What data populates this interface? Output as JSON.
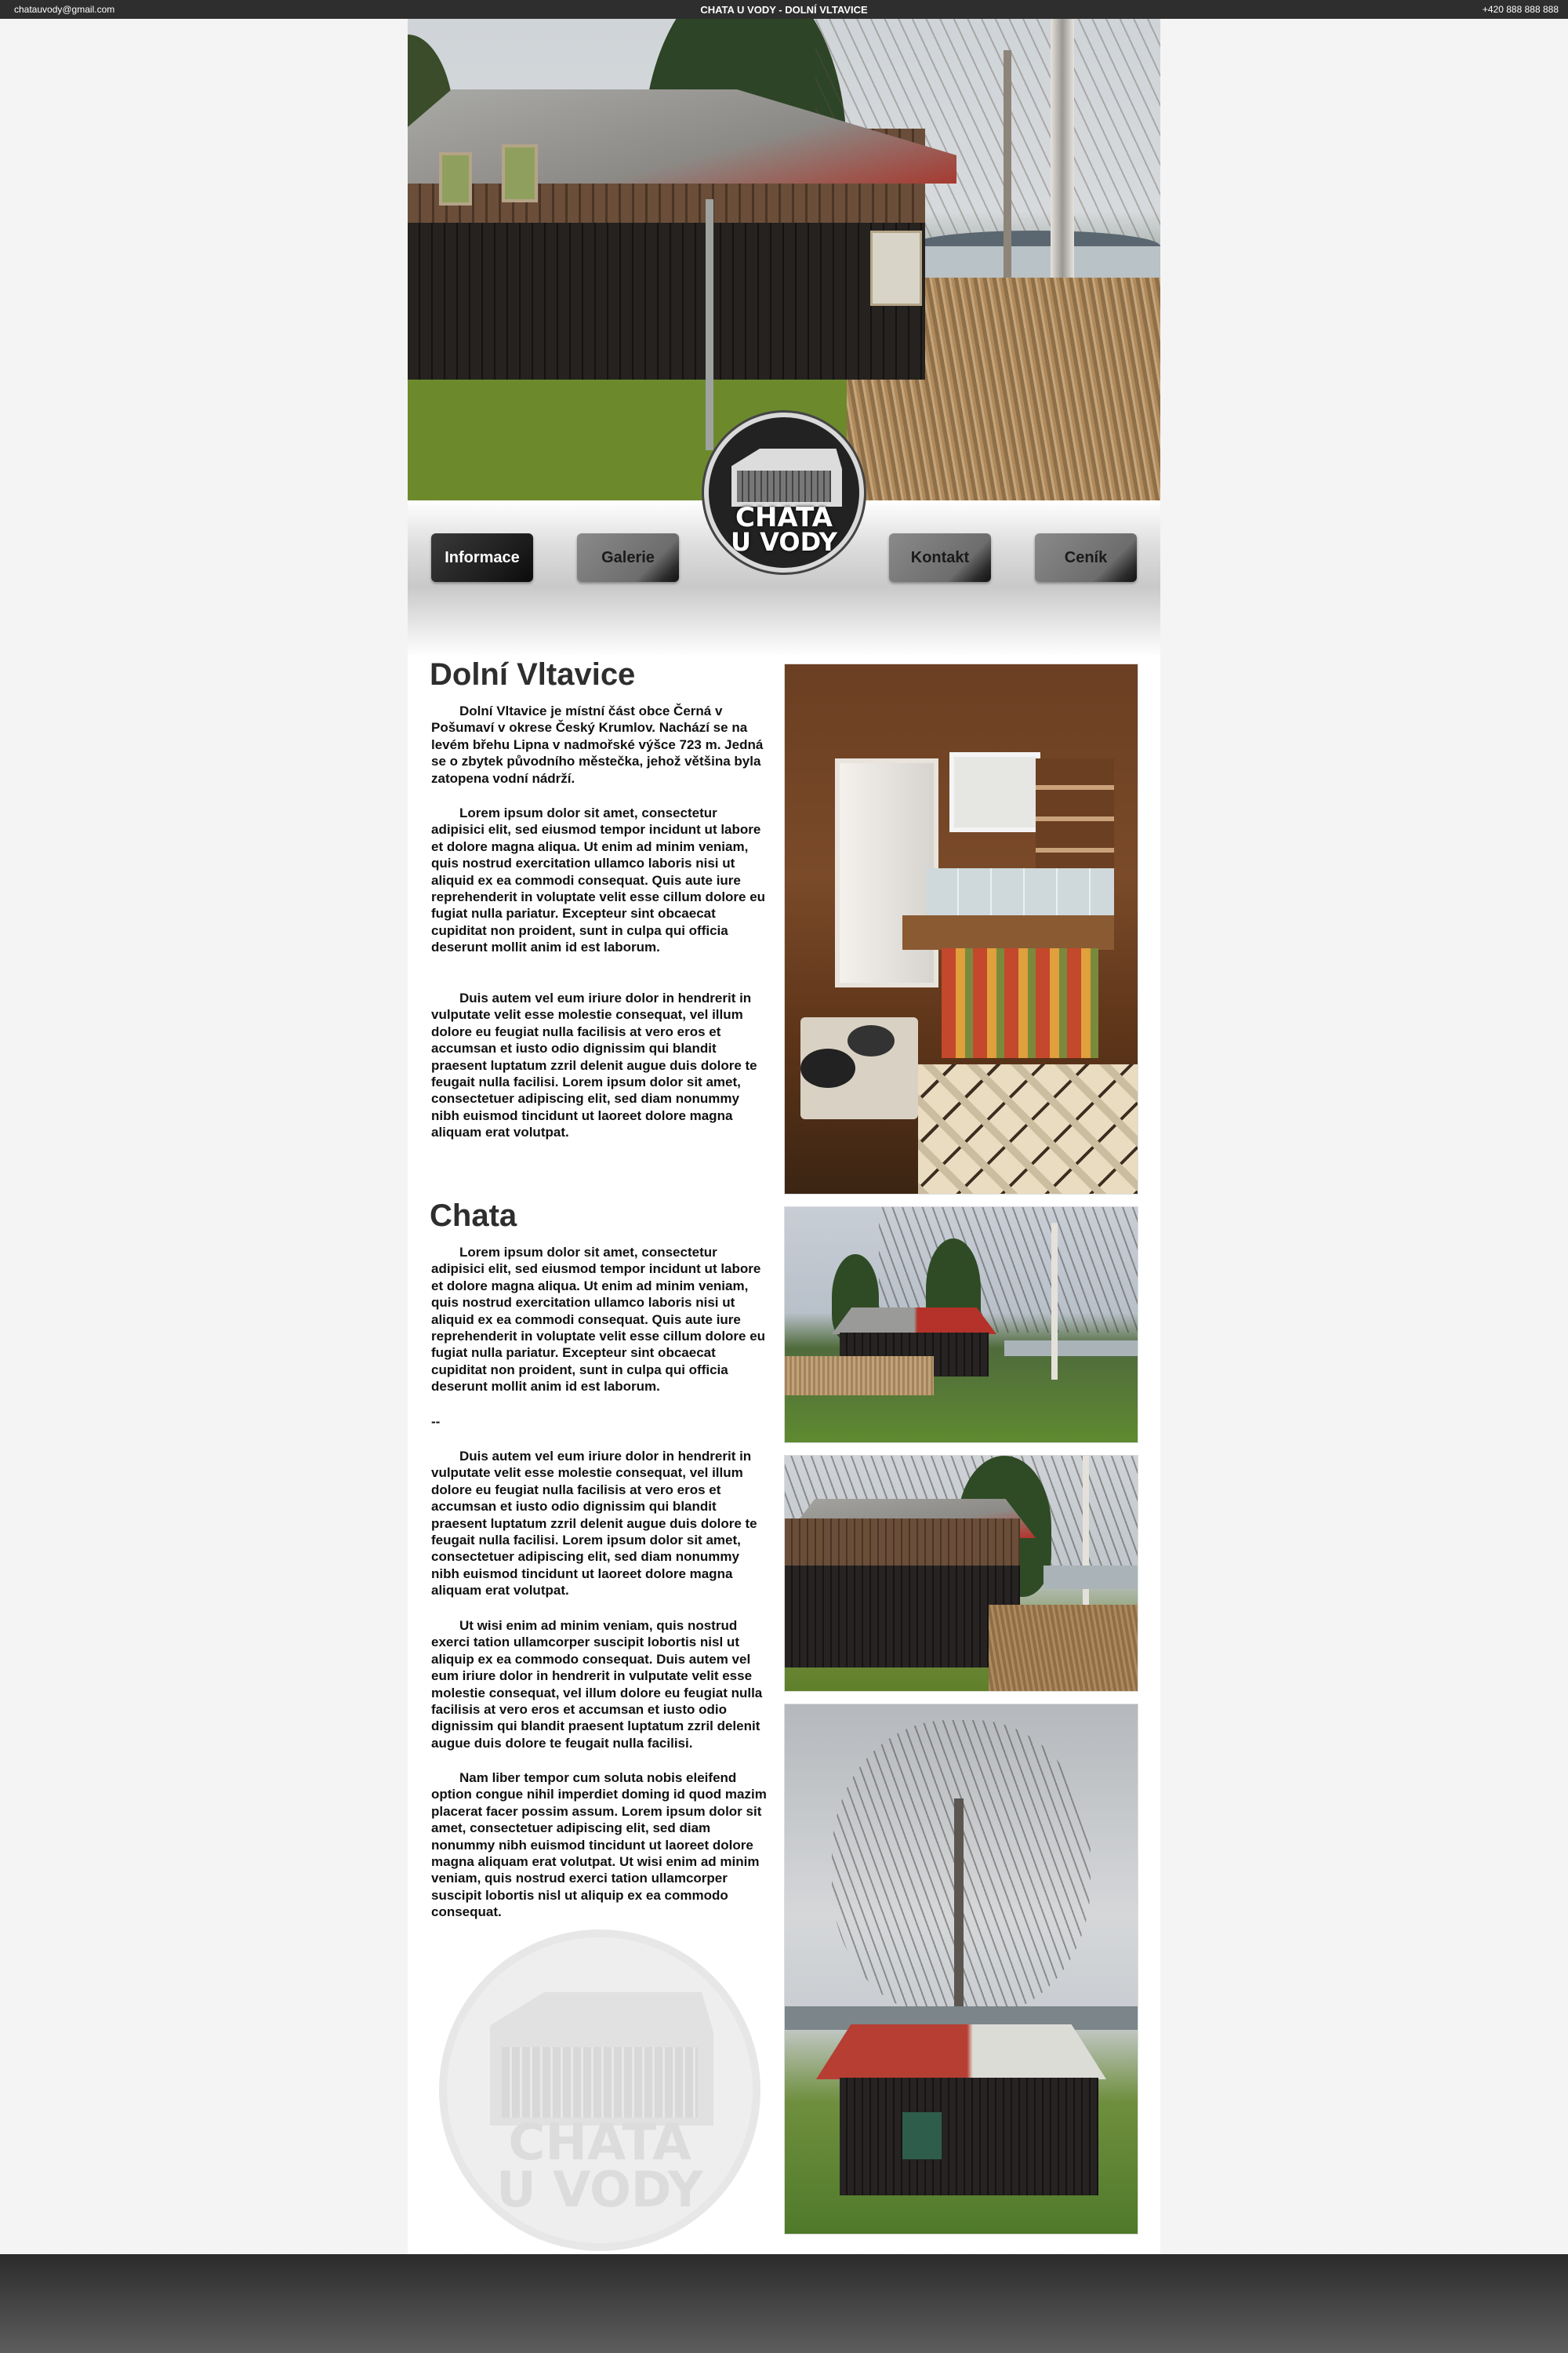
{
  "topbar": {
    "email": "chatauvody@gmail.com",
    "title": "CHATA U VODY - DOLNÍ VLTAVICE",
    "phone": "+420 888 888 888"
  },
  "nav": {
    "items": [
      {
        "label": "Informace",
        "active": true
      },
      {
        "label": "Galerie"
      },
      {
        "label": "Kontakt"
      },
      {
        "label": "Ceník"
      }
    ]
  },
  "logo": {
    "line1": "CHATA",
    "line2": "U VODY"
  },
  "sections": {
    "dolni": {
      "title": "Dolní Vltavice",
      "paragraphs": [
        "Dolní Vltavice je místní část obce Černá v Pošumaví v okrese Český Krumlov. Nachází se na levém břehu Lipna v nadmořské výšce 723 m. Jedná se o zbytek původního městečka, jehož většina byla zatopena vodní nádrží.",
        "Lorem ipsum dolor sit amet, consectetur adipisici elit, sed eiusmod tempor incidunt ut labore et dolore magna aliqua. Ut enim ad minim veniam, quis nostrud exercitation ullamco laboris nisi ut aliquid ex ea commodi consequat. Quis aute iure reprehenderit in voluptate velit esse cillum dolore eu fugiat nulla pariatur. Excepteur sint obcaecat cupiditat non proident, sunt in culpa qui officia deserunt mollit anim id est laborum.",
        "Duis autem vel eum iriure dolor in hendrerit in vulputate velit esse molestie consequat, vel illum dolore eu feugiat nulla facilisis at vero eros et accumsan et iusto odio dignissim qui blandit praesent luptatum zzril delenit augue duis dolore te feugait nulla facilisi. Lorem ipsum dolor sit amet, consectetuer adipiscing elit, sed diam nonummy nibh euismod tincidunt ut laoreet dolore magna aliquam erat volutpat."
      ]
    },
    "chata": {
      "title": "Chata",
      "paragraphs": [
        "Lorem ipsum dolor sit amet, consectetur adipisici elit, sed eiusmod tempor incidunt ut labore et dolore magna aliqua. Ut enim ad minim veniam, quis nostrud exercitation ullamco laboris nisi ut aliquid ex ea commodi consequat. Quis aute iure reprehenderit in voluptate velit esse cillum dolore eu fugiat nulla pariatur. Excepteur sint obcaecat cupiditat non proident, sunt in culpa qui officia deserunt mollit anim id est laborum.",
        "--",
        "Duis autem vel eum iriure dolor in hendrerit in vulputate velit esse molestie consequat, vel illum dolore eu feugiat nulla facilisis at vero eros et accumsan et iusto odio dignissim qui blandit praesent luptatum zzril delenit augue duis dolore te feugait nulla facilisi. Lorem ipsum dolor sit amet, consectetuer adipiscing elit, sed diam nonummy nibh euismod tincidunt ut laoreet dolore magna aliquam erat volutpat.",
        "Ut wisi enim ad minim veniam, quis nostrud exerci tation ullamcorper suscipit lobortis nisl ut aliquip ex ea commodo consequat. Duis autem vel eum iriure dolor in hendrerit in vulputate velit esse molestie consequat, vel illum dolore eu feugiat nulla facilisis at vero eros et accumsan et iusto odio dignissim qui blandit praesent luptatum zzril delenit augue duis dolore te feugait nulla facilisi.",
        "Nam liber tempor cum soluta nobis eleifend option congue nihil imperdiet doming id quod mazim placerat facer possim assum. Lorem ipsum dolor sit amet, consectetuer adipiscing elit, sed diam nonummy nibh euismod tincidunt ut laoreet dolore magna aliquam erat volutpat. Ut wisi enim ad minim veniam, quis nostrud exerci tation ullamcorper suscipit lobortis nisl ut aliquip ex ea commodo consequat."
      ]
    }
  },
  "watermark": {
    "line1": "CHATA",
    "line2": "U VODY"
  },
  "colors": {
    "topbar": "#2e2e2e",
    "nav_active": "#1b1b1b",
    "nav_button": "#6d6d6d",
    "heading": "#2e2e2e"
  }
}
